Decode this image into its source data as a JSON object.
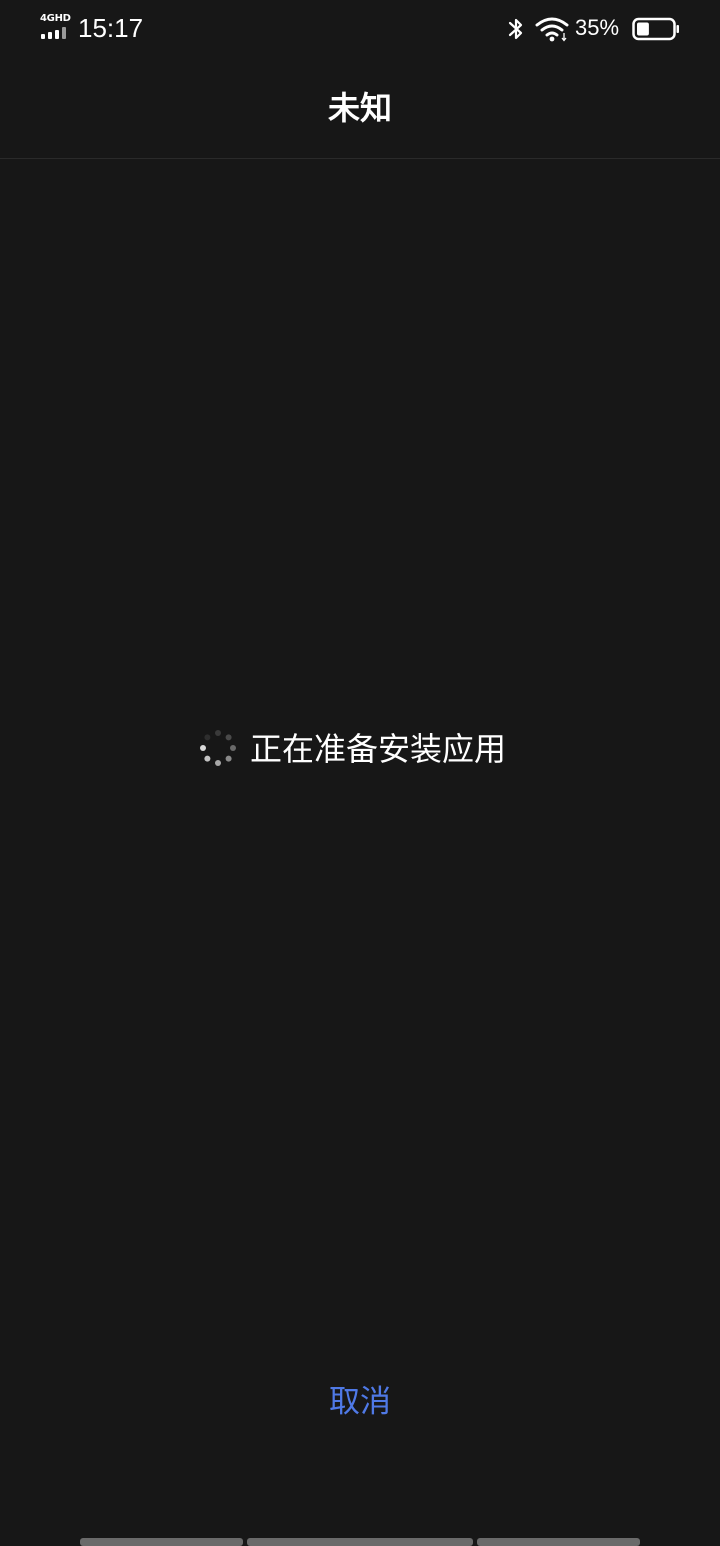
{
  "status_bar": {
    "network_type": "4GHD",
    "time": "15:17",
    "battery_percent": "35%",
    "battery_level": 0.35,
    "icons": [
      "signal-icon",
      "bluetooth-icon",
      "wifi-icon",
      "battery-icon"
    ]
  },
  "header": {
    "title": "未知"
  },
  "loading": {
    "message": "正在准备安装应用",
    "icon": "spinner-icon"
  },
  "actions": {
    "cancel_label": "取消"
  },
  "colors": {
    "background": "#171717",
    "accent": "#4f79e6",
    "text": "#ffffff",
    "divider": "#2a2a2a"
  }
}
